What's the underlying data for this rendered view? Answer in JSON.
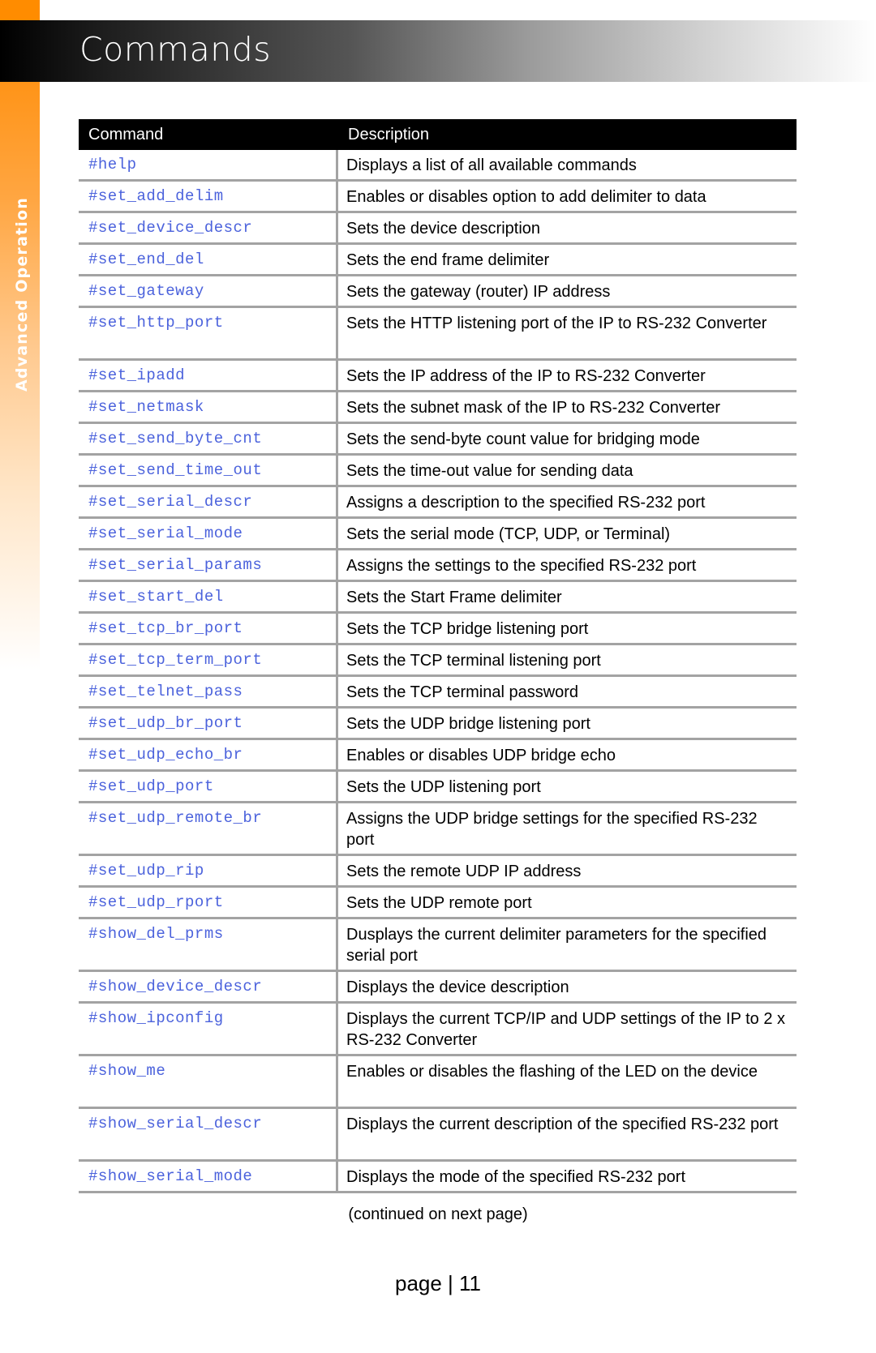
{
  "sidebar": {
    "section_label": "Advanced Operation"
  },
  "banner": {
    "title": "Commands"
  },
  "table": {
    "headers": {
      "command": "Command",
      "description": "Description"
    },
    "rows": [
      {
        "command": "#help",
        "description": "Displays a list of all available commands",
        "lines": 1
      },
      {
        "command": "#set_add_delim",
        "description": "Enables or disables option to add delimiter to data",
        "lines": 1
      },
      {
        "command": "#set_device_descr",
        "description": "Sets the device description",
        "lines": 1
      },
      {
        "command": "#set_end_del",
        "description": "Sets the end frame delimiter",
        "lines": 1
      },
      {
        "command": "#set_gateway",
        "description": "Sets the gateway (router) IP address",
        "lines": 1
      },
      {
        "command": "#set_http_port",
        "description": "Sets the HTTP listening port of the IP to RS-232 Converter",
        "lines": 2
      },
      {
        "command": "#set_ipadd",
        "description": "Sets the IP address of the IP to RS-232 Converter",
        "lines": 1
      },
      {
        "command": "#set_netmask",
        "description": "Sets the subnet mask of the IP to RS-232 Converter",
        "lines": 1
      },
      {
        "command": "#set_send_byte_cnt",
        "description": "Sets the send-byte count value for bridging mode",
        "lines": 1
      },
      {
        "command": "#set_send_time_out",
        "description": "Sets the time-out value for sending data",
        "lines": 1
      },
      {
        "command": "#set_serial_descr",
        "description": "Assigns a description to the specified RS-232 port",
        "lines": 1
      },
      {
        "command": "#set_serial_mode",
        "description": "Sets the serial mode (TCP, UDP, or Terminal)",
        "lines": 1
      },
      {
        "command": "#set_serial_params",
        "description": "Assigns the settings to the specified RS-232 port",
        "lines": 1
      },
      {
        "command": "#set_start_del",
        "description": "Sets the Start Frame delimiter",
        "lines": 1
      },
      {
        "command": "#set_tcp_br_port",
        "description": "Sets the TCP bridge listening port",
        "lines": 1
      },
      {
        "command": "#set_tcp_term_port",
        "description": "Sets the TCP terminal listening port",
        "lines": 1
      },
      {
        "command": "#set_telnet_pass",
        "description": "Sets the TCP terminal password",
        "lines": 1
      },
      {
        "command": "#set_udp_br_port",
        "description": "Sets the UDP bridge listening port",
        "lines": 1
      },
      {
        "command": "#set_udp_echo_br",
        "description": "Enables or disables UDP bridge echo",
        "lines": 1
      },
      {
        "command": "#set_udp_port",
        "description": "Sets the UDP listening port",
        "lines": 1
      },
      {
        "command": "#set_udp_remote_br",
        "description": "Assigns the UDP bridge settings for the specified RS-232 port",
        "lines": 2
      },
      {
        "command": "#set_udp_rip",
        "description": "Sets the remote UDP IP address",
        "lines": 1
      },
      {
        "command": "#set_udp_rport",
        "description": "Sets the UDP remote port",
        "lines": 1
      },
      {
        "command": "#show_del_prms",
        "description": "Dusplays the current delimiter parameters for the specified serial port",
        "lines": 2
      },
      {
        "command": "#show_device_descr",
        "description": "Displays the device description",
        "lines": 1
      },
      {
        "command": "#show_ipconfig",
        "description": "Displays the current TCP/IP and UDP settings of the IP to 2 x RS-232 Converter",
        "lines": 2
      },
      {
        "command": "#show_me",
        "description": "Enables or disables the flashing of the LED on the device",
        "lines": 2
      },
      {
        "command": "#show_serial_descr",
        "description": "Displays the current description of the specified RS-232 port",
        "lines": 2
      },
      {
        "command": "#show_serial_mode",
        "description": "Displays the mode of the specified RS-232 port",
        "lines": 1
      }
    ]
  },
  "footer": {
    "continued_note": "(continued on next page)",
    "page_label": "page | 11"
  },
  "colors": {
    "accent_orange": "#ff8c00",
    "command_text": "#4b62dc",
    "row_border": "#a3a3a3"
  }
}
